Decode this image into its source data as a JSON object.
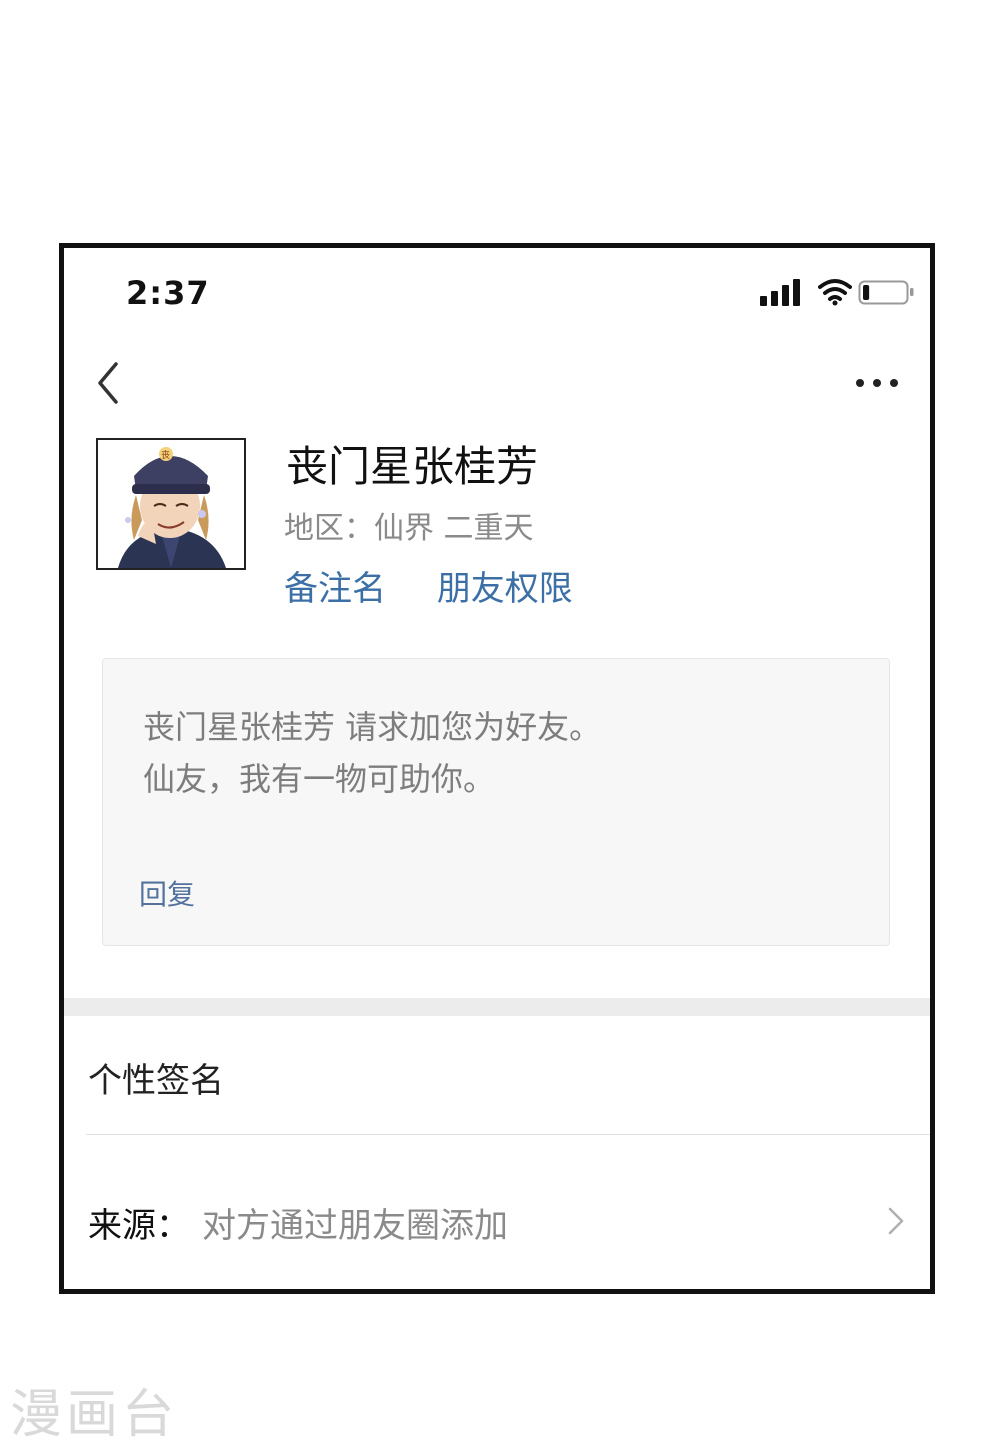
{
  "status_bar": {
    "time": "2:37",
    "battery_level": 0.15
  },
  "nav": {
    "back_icon": "chevron-left-icon",
    "more_icon": "more-dots-icon"
  },
  "profile": {
    "name": "丧门星张桂芳",
    "region": "地区：仙界 二重天",
    "actions": {
      "remark": "备注名",
      "permissions": "朋友权限"
    }
  },
  "request": {
    "line1": "丧门星张桂芳 请求加您为好友。",
    "line2": "仙友，我有一物可助你。",
    "reply": "回复"
  },
  "details": {
    "signature_label": "个性签名",
    "source_label": "来源：",
    "source_value": "对方通过朋友圈添加"
  },
  "watermark": "漫画台",
  "colors": {
    "link": "#3c6fa6",
    "card_bg": "#f7f7f7"
  }
}
